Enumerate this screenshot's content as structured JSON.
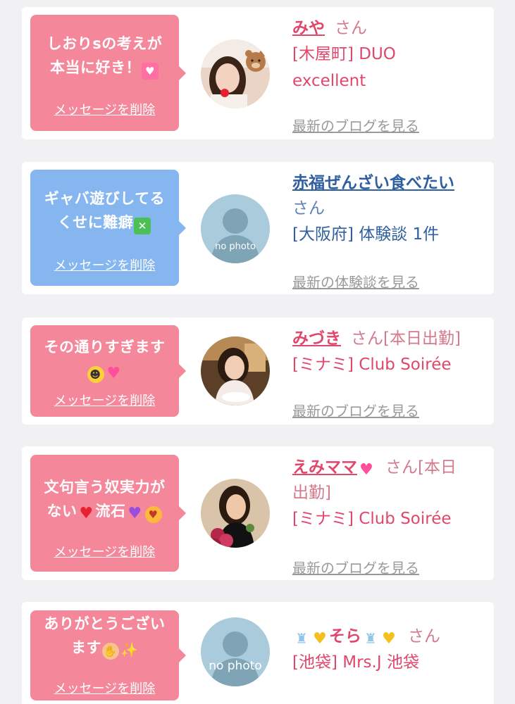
{
  "messages": [
    {
      "bubble_line1": "しおりsの考えが",
      "bubble_line2": "本当に好き！",
      "delete_label": "メッセージを削除",
      "name": "みや",
      "honorific": "さん",
      "shop_line1": "[木屋町] DUO",
      "shop_line2": "excellent",
      "link": "最新のブログを見る"
    },
    {
      "bubble_line1": "ギャバ遊びしてる",
      "bubble_line2": "くせに難癖",
      "delete_label": "メッセージを削除",
      "name": "赤福ぜんざい食べたい",
      "honorific": "さん",
      "shop_line1": "[大阪府] 体験談 1件",
      "link": "最新の体験談を見る",
      "avatar_caption": "no photo"
    },
    {
      "bubble_line1": "その通りすぎます",
      "delete_label": "メッセージを削除",
      "name": "みづき",
      "honorific": "さん[本日出勤]",
      "shop_line1": "[ミナミ] Club Soirée",
      "link": "最新のブログを見る"
    },
    {
      "bubble_line1": "文句言う奴実力が",
      "bubble_line2a": "ない",
      "bubble_line2b": "流石",
      "delete_label": "メッセージを削除",
      "name": "えみママ",
      "honorific_a": "さん[本日",
      "honorific_b": "出勤]",
      "shop_line1": "[ミナミ] Club Soirée",
      "link": "最新のブログを見る"
    },
    {
      "bubble_line1": "ありがとうござい",
      "bubble_line2": "ます",
      "delete_label": "メッセージを削除",
      "name": "そら",
      "honorific": "さん",
      "shop_line1": "[池袋] Mrs.J 池袋",
      "avatar_caption": "no photo"
    }
  ],
  "colors": {
    "pink_bubble": "#f5879b",
    "blue_bubble": "#86b6ef",
    "pink_text": "#e0476b",
    "blue_text": "#2f5f9e",
    "link_gray": "#9a9a9a"
  }
}
